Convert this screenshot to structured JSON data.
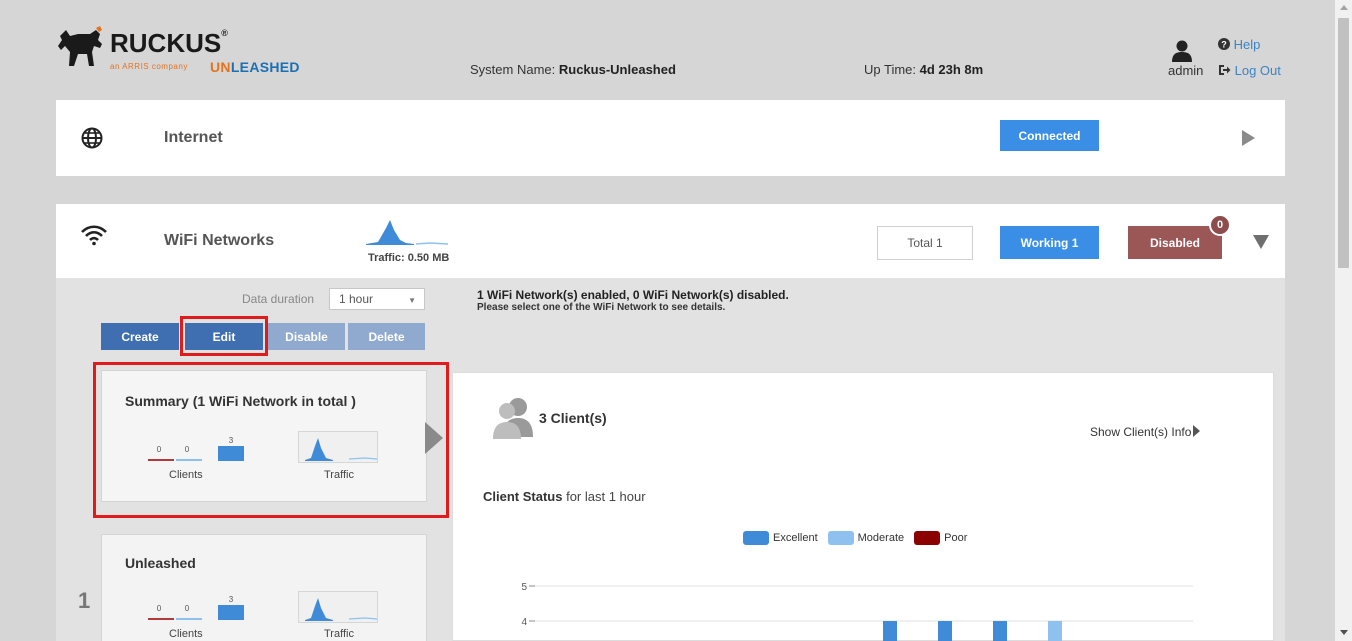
{
  "header": {
    "brand": "RUCKUS",
    "brand_tm": "®",
    "tagline": "an ARRIS company",
    "product_un": "UN",
    "product_leashed": "LEASHED",
    "system_name_label": "System Name:",
    "system_name_value": "Ruckus-Unleashed",
    "uptime_label": "Up Time:",
    "uptime_value": "4d 23h 8m",
    "user": "admin",
    "help_label": "Help",
    "logout_label": "Log Out"
  },
  "internet": {
    "title": "Internet",
    "status": "Connected"
  },
  "wifi": {
    "title": "WiFi Networks",
    "traffic_label": "Traffic: 0.50 MB",
    "total_label": "Total 1",
    "working_label": "Working 1",
    "disabled_label": "Disabled",
    "disabled_badge": "0",
    "duration_label": "Data duration",
    "duration_value": "1 hour",
    "message_line1": "1 WiFi Network(s) enabled, 0 WiFi Network(s) disabled.",
    "message_line2": "Please select one of the WiFi Network to see details.",
    "actions": {
      "create": "Create",
      "edit": "Edit",
      "disable": "Disable",
      "delete": "Delete"
    },
    "summary_card": {
      "title": "Summary (1 WiFi Network in total )",
      "bar_values": [
        "0",
        "0",
        "3"
      ],
      "clients_label": "Clients",
      "traffic_label": "Traffic"
    },
    "network_card": {
      "index": "1",
      "title": "Unleashed",
      "bar_values": [
        "0",
        "0",
        "3"
      ],
      "clients_label": "Clients",
      "traffic_label": "Traffic"
    }
  },
  "details": {
    "clients_count": "3 Client(s)",
    "show_info": "Show Client(s) Info",
    "status_title_bold": "Client Status",
    "status_title_rest": " for last 1 hour",
    "legend": [
      {
        "label": "Excellent",
        "color": "#3f8bd8"
      },
      {
        "label": "Moderate",
        "color": "#8ec1ef"
      },
      {
        "label": "Poor",
        "color": "#8b0000"
      }
    ]
  },
  "chart_data": {
    "type": "bar",
    "title": "Client Status for last 1 hour",
    "ytick_labels": [
      "5",
      "4"
    ],
    "series": [
      {
        "name": "Excellent",
        "color": "#3f8bd8"
      },
      {
        "name": "Moderate",
        "color": "#8ec1ef"
      },
      {
        "name": "Poor",
        "color": "#8b0000"
      }
    ]
  },
  "colors": {
    "connected": "#3a8ee6",
    "working": "#3a8ee6",
    "disabled": "#9b5656",
    "action_blue": "#3f6fb1",
    "action_disabled": "#8fa9cf",
    "highlight": "#e11b1b"
  }
}
